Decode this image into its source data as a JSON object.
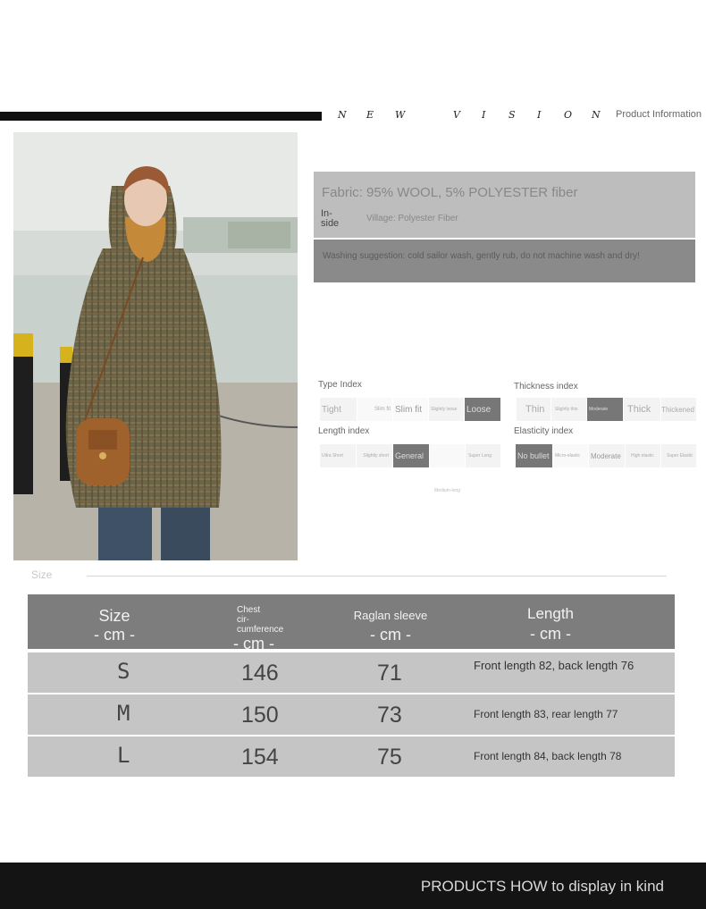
{
  "header": {
    "brand_letters": [
      "N",
      "E",
      "W",
      "V",
      "I",
      "S",
      "I",
      "O",
      "N"
    ],
    "product_info": "Product Information"
  },
  "product_photo": {
    "alt": "Model wearing plaid hooded wool coat with brown crossbody bag"
  },
  "fabric": {
    "title": "Fabric: 95% WOOL, 5% POLYESTER fiber",
    "inside_label": "In-side",
    "inside_value": "Village: Polyester Fiber",
    "washing": "Washing suggestion: cold sailor wash, gently rub, do not machine wash and dry!"
  },
  "indexes": {
    "type": {
      "label": "Type Index",
      "options": [
        "Tight",
        "Slim fit",
        "Slim fit",
        "Slightly loose",
        "Loose"
      ],
      "active": 4
    },
    "thickness": {
      "label": "Thickness index",
      "options": [
        "Thin",
        "Slightly thin",
        "Moderate",
        "Thick",
        "Thickened"
      ],
      "active": 2
    },
    "length": {
      "label": "Length index",
      "options": [
        "Ultra Short",
        "Slightly short",
        "General",
        "",
        "Super Long"
      ],
      "active": 2
    },
    "elasticity": {
      "label": "Elasticity index",
      "options": [
        "No bullet",
        "Micro-elastic",
        "Moderate",
        "High elastic",
        "Super Elastic"
      ],
      "active": 0
    },
    "medium_note": "Medium-long"
  },
  "size_section": {
    "heading": "Size",
    "columns": [
      {
        "label": "Size",
        "unit": "- cm -"
      },
      {
        "label": "Chest cir-cumference",
        "unit": "- cm -"
      },
      {
        "label": "Raglan sleeve",
        "unit": "- cm -"
      },
      {
        "label": "Length",
        "unit": "- cm -"
      }
    ],
    "rows": [
      {
        "size": "S",
        "chest": "146",
        "raglan": "71",
        "length": "Front length 82, back length 76"
      },
      {
        "size": "M",
        "chest": "150",
        "raglan": "73",
        "length": "Front length 83, rear length 77"
      },
      {
        "size": "L",
        "chest": "154",
        "raglan": "75",
        "length": "Front length 84, back length 78"
      }
    ]
  },
  "footer": {
    "text": "PRODUCTS HOW to display in kind"
  },
  "colors": {
    "header_bar": "#111111",
    "table_head": "#7d7d7d",
    "table_row": "#c5c5c5",
    "footer": "#141414",
    "active_cell": "#777777"
  }
}
